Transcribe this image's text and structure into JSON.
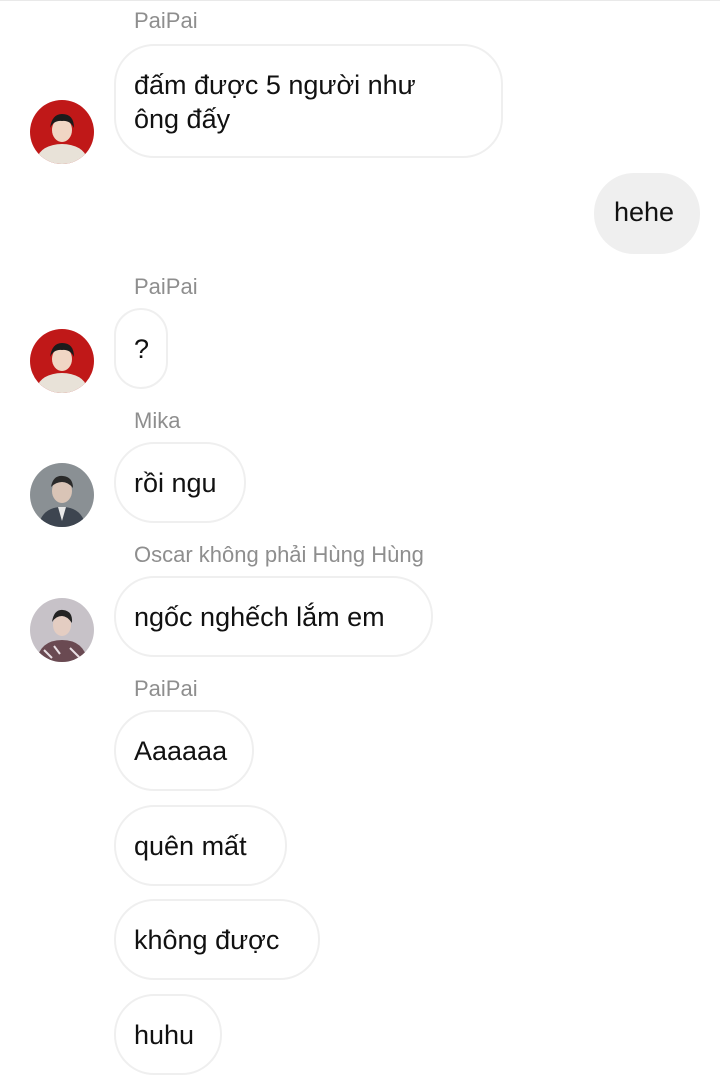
{
  "conversation": {
    "messages": [
      {
        "sender": "PaiPai",
        "text": "đấm được 5 người như ông đấy"
      },
      {
        "sender": "",
        "text": "hehe",
        "mine": true
      },
      {
        "sender": "PaiPai",
        "text": "?"
      },
      {
        "sender": "Mika",
        "text": "rồi ngu"
      },
      {
        "sender": "Oscar không phải Hùng Hùng",
        "text": "ngốc nghếch lắm em"
      },
      {
        "sender": "PaiPai",
        "text": "Aaaaaa"
      },
      {
        "sender": "",
        "text": "quên mất"
      },
      {
        "sender": "",
        "text": "không được"
      },
      {
        "sender": "",
        "text": "huhu"
      }
    ]
  },
  "avatars": {
    "paipai": "avatar-paipai-red",
    "mika": "avatar-mika-gray",
    "oscar": "avatar-oscar-gray"
  },
  "colors": {
    "bubble_border": "#efefef",
    "my_bubble_bg": "#efefef",
    "sender_name": "#8e8e8e",
    "text": "#111111"
  }
}
